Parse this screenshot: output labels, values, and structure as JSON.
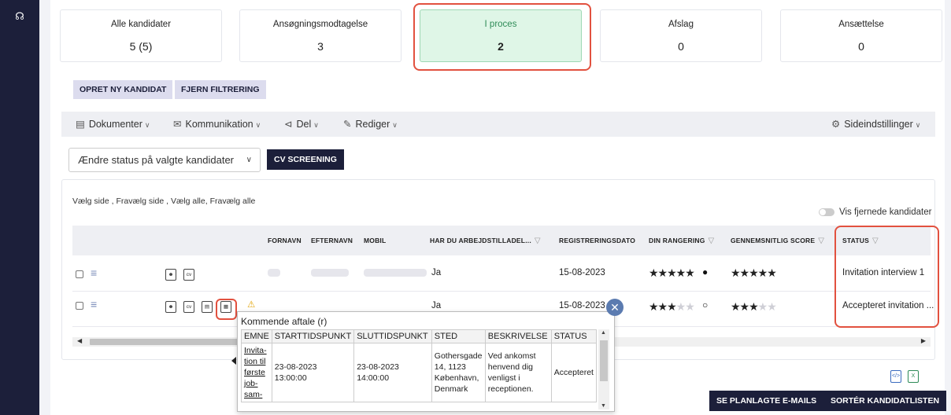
{
  "sidebar": {
    "icon": "headset-icon"
  },
  "status_cards": [
    {
      "label": "Alle kandidater",
      "count": "5 (5)"
    },
    {
      "label": "Ansøgningsmodtagelse",
      "count": "3"
    },
    {
      "label": "I proces",
      "count": "2"
    },
    {
      "label": "Afslag",
      "count": "0"
    },
    {
      "label": "Ansættelse",
      "count": "0"
    }
  ],
  "actions": {
    "create_candidate": "OPRET NY KANDIDAT",
    "remove_filter": "FJERN FILTRERING"
  },
  "toolbar": {
    "documents": "Dokumenter",
    "communication": "Kommunikation",
    "share": "Del",
    "edit": "Rediger",
    "page_settings": "Sideindstillinger"
  },
  "status_select": {
    "value": "Ændre status på valgte kandidater"
  },
  "cv_screening": "CV SCREENING",
  "selection_links": {
    "select_page": "Vælg side",
    "deselect_page": "Fravælg side",
    "select_all": "Vælg alle",
    "deselect_all": "Fravælg alle"
  },
  "show_removed": "Vis fjernede kandidater",
  "columns": {
    "firstname": "FORNAVN",
    "lastname": "EFTERNAVN",
    "mobile": "MOBIL",
    "work_permit": "HAR DU ARBEJDSTILLADEL...",
    "registration_date": "REGISTRERINGSDATO",
    "your_rating": "DIN RANGERING",
    "avg_score": "GENNEMSNITLIG SCORE",
    "status": "STATUS"
  },
  "rows": [
    {
      "work_permit": "Ja",
      "registration_date": "15-08-2023",
      "your_rating": 5,
      "avg_score": 5,
      "status": "Invitation interview 1"
    },
    {
      "work_permit": "Ja",
      "registration_date": "15-08-2023",
      "your_rating": 3,
      "avg_score": 3,
      "status": "Accepteret invitation ..."
    }
  ],
  "popup": {
    "title": "Kommende aftale (r)",
    "headers": [
      "EMNE",
      "STARTTIDSPUNKT",
      "SLUTTIDSPUNKT",
      "STED",
      "BESKRIVELSE",
      "STATUS"
    ],
    "row": {
      "subject": "Invita- tion til første job- sam-",
      "start": "23-08-2023 13:00:00",
      "end": "23-08-2023 14:00:00",
      "place": "Gothersgade 14, 1123 København, Denmark",
      "description": "Ved ankomst henvend dig venligst i receptionen.",
      "status": "Accepteret"
    }
  },
  "bottom": {
    "planned_emails": "SE PLANLAGTE E-MAILS",
    "sort_list": "SORTÉR KANDIDATLISTEN"
  },
  "colors": {
    "navy": "#1c1f3a",
    "highlight": "#e2513f",
    "active_card": "#dff6e7"
  }
}
